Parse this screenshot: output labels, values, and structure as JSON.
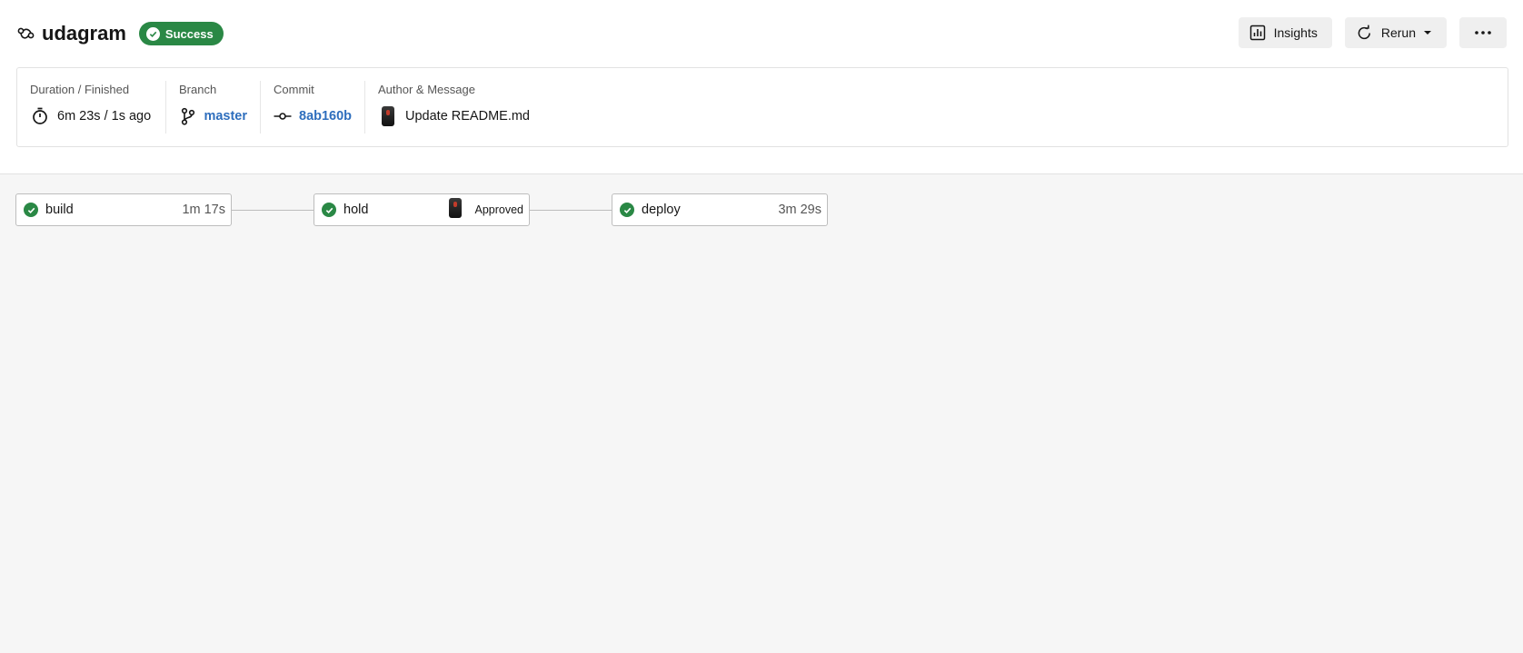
{
  "header": {
    "title": "udagram",
    "status_badge": "Success",
    "actions": {
      "insights_label": "Insights",
      "rerun_label": "Rerun"
    }
  },
  "info": {
    "duration": {
      "label": "Duration / Finished",
      "value": "6m 23s / 1s ago"
    },
    "branch": {
      "label": "Branch",
      "value": "master"
    },
    "commit": {
      "label": "Commit",
      "value": "8ab160b"
    },
    "author": {
      "label": "Author & Message",
      "message": "Update README.md"
    }
  },
  "jobs": [
    {
      "name": "build",
      "duration": "1m 17s",
      "status": "success"
    },
    {
      "name": "hold",
      "status_text": "Approved",
      "status": "success"
    },
    {
      "name": "deploy",
      "duration": "3m 29s",
      "status": "success"
    }
  ],
  "colors": {
    "success": "#2a8845",
    "link": "#2e6ebd",
    "canvas": "#f6f6f6"
  }
}
